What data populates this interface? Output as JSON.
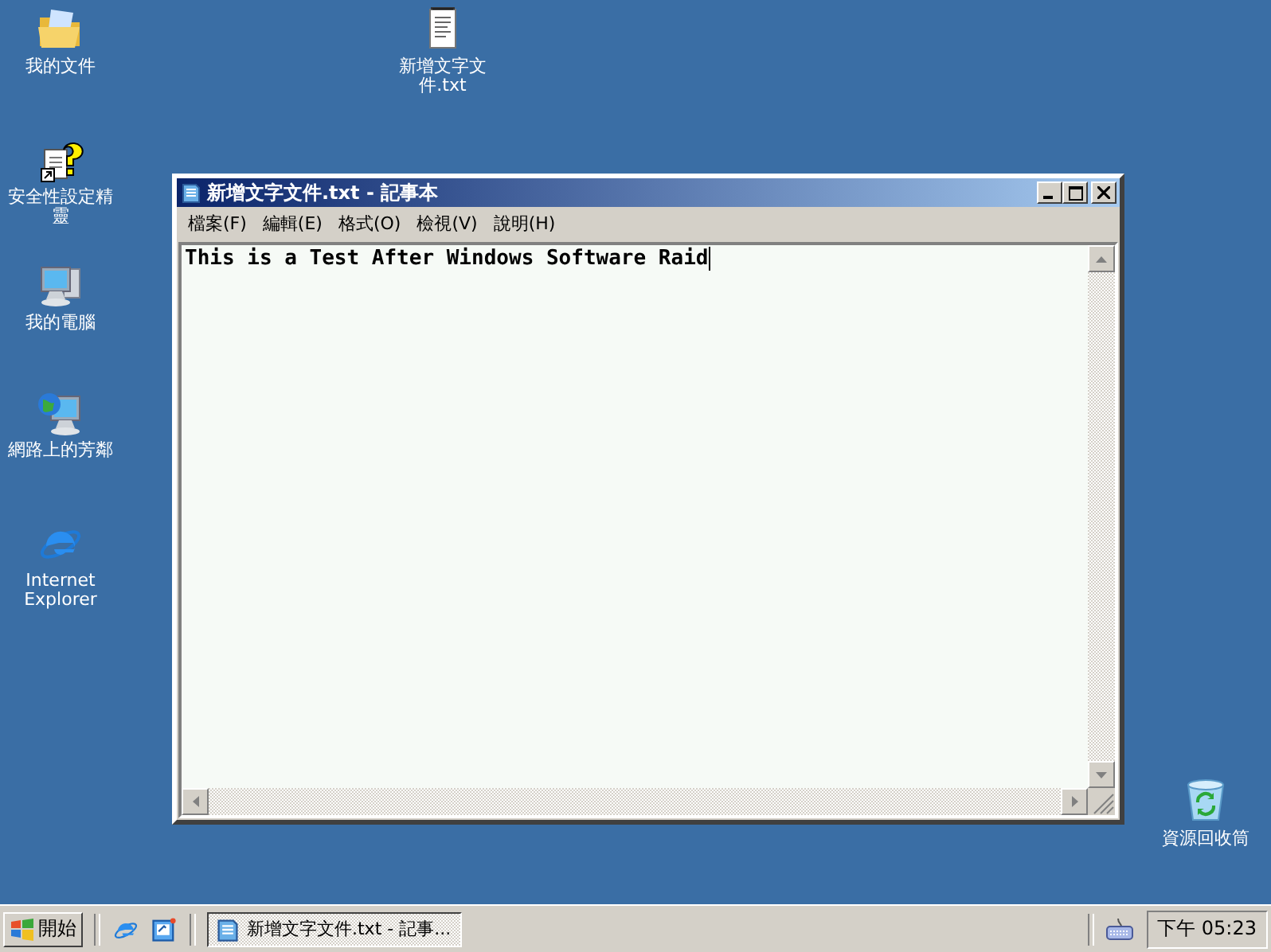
{
  "desktop_icons": [
    {
      "kind": "folder",
      "label": "我的文件"
    },
    {
      "kind": "wizard",
      "label": "安全性設定精靈"
    },
    {
      "kind": "computer",
      "label": "我的電腦"
    },
    {
      "kind": "network",
      "label": "網路上的芳鄰"
    },
    {
      "kind": "ie",
      "label": "Internet Explorer"
    },
    {
      "kind": "textfile",
      "label": "新增文字文件.txt"
    },
    {
      "kind": "recycle",
      "label": "資源回收筒"
    }
  ],
  "window": {
    "title": "新增文字文件.txt - 記事本",
    "menu": [
      "檔案(F)",
      "編輯(E)",
      "格式(O)",
      "檢視(V)",
      "說明(H)"
    ],
    "content": "This is a Test After Windows Software Raid"
  },
  "taskbar": {
    "start": "開始",
    "quick_launch": [
      {
        "kind": "ie"
      },
      {
        "kind": "desktop"
      }
    ],
    "tasks": [
      {
        "label": "新增文字文件.txt - 記事...",
        "selected": true
      }
    ],
    "clock": "下午 05:23"
  }
}
